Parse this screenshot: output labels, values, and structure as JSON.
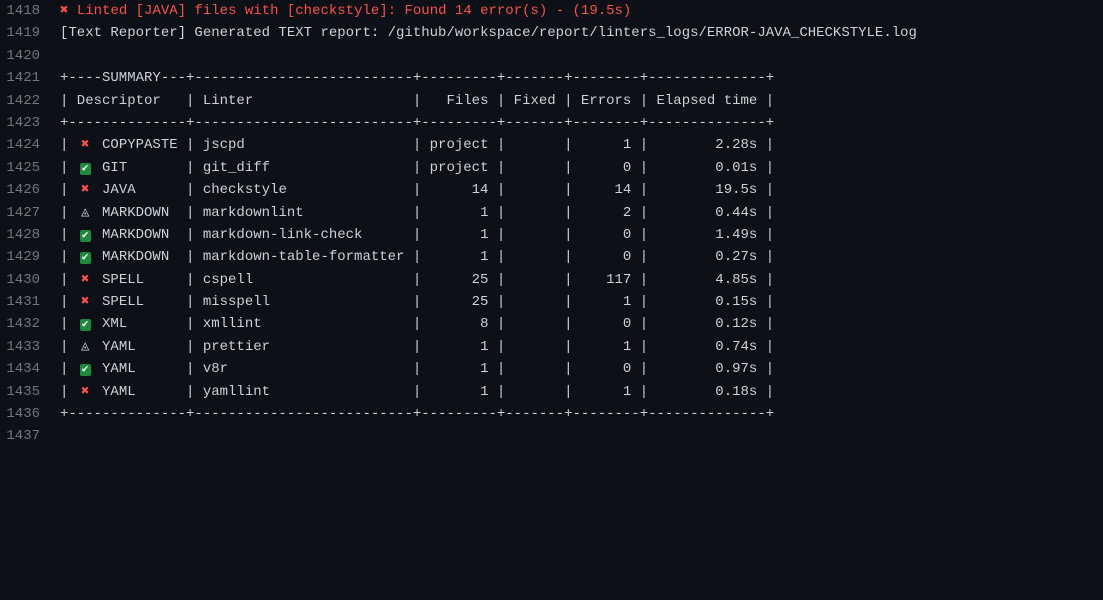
{
  "lines": {
    "l1418_no": "1418",
    "l1419_no": "1419",
    "l1420_no": "1420",
    "l1421_no": "1421",
    "l1422_no": "1422",
    "l1423_no": "1423",
    "l1424_no": "1424",
    "l1425_no": "1425",
    "l1426_no": "1426",
    "l1427_no": "1427",
    "l1428_no": "1428",
    "l1429_no": "1429",
    "l1430_no": "1430",
    "l1431_no": "1431",
    "l1432_no": "1432",
    "l1433_no": "1433",
    "l1434_no": "1434",
    "l1435_no": "1435",
    "l1436_no": "1436",
    "l1437_no": "1437"
  },
  "msg1418_icon": "✖",
  "msg1418_text": " Linted [JAVA] files with [checkstyle]: Found 14 error(s) - (19.5s)",
  "msg1419": "[Text Reporter] Generated TEXT report: /github/workspace/report/linters_logs/ERROR-JAVA_CHECKSTYLE.log",
  "border_top": "+----SUMMARY---+--------------------------+---------+-------+--------+--------------+",
  "header_row": "| Descriptor   | Linter                   |   Files | Fixed | Errors | Elapsed time |",
  "border_mid": "+--------------+--------------------------+---------+-------+--------+--------------+",
  "border_bot": "+--------------+--------------------------+---------+-------+--------+--------------+",
  "icons": {
    "x": "✖",
    "check": "✔",
    "warn": "◬"
  },
  "rows": [
    {
      "status": "x",
      "desc": "COPYPASTE",
      "linter": "jscpd",
      "files": "project",
      "fixed": "",
      "errors": "1",
      "time": "2.28s"
    },
    {
      "status": "check",
      "desc": "GIT",
      "linter": "git_diff",
      "files": "project",
      "fixed": "",
      "errors": "0",
      "time": "0.01s"
    },
    {
      "status": "x",
      "desc": "JAVA",
      "linter": "checkstyle",
      "files": "14",
      "fixed": "",
      "errors": "14",
      "time": "19.5s"
    },
    {
      "status": "warn",
      "desc": "MARKDOWN",
      "linter": "markdownlint",
      "files": "1",
      "fixed": "",
      "errors": "2",
      "time": "0.44s"
    },
    {
      "status": "check",
      "desc": "MARKDOWN",
      "linter": "markdown-link-check",
      "files": "1",
      "fixed": "",
      "errors": "0",
      "time": "1.49s"
    },
    {
      "status": "check",
      "desc": "MARKDOWN",
      "linter": "markdown-table-formatter",
      "files": "1",
      "fixed": "",
      "errors": "0",
      "time": "0.27s"
    },
    {
      "status": "x",
      "desc": "SPELL",
      "linter": "cspell",
      "files": "25",
      "fixed": "",
      "errors": "117",
      "time": "4.85s"
    },
    {
      "status": "x",
      "desc": "SPELL",
      "linter": "misspell",
      "files": "25",
      "fixed": "",
      "errors": "1",
      "time": "0.15s"
    },
    {
      "status": "check",
      "desc": "XML",
      "linter": "xmllint",
      "files": "8",
      "fixed": "",
      "errors": "0",
      "time": "0.12s"
    },
    {
      "status": "warn",
      "desc": "YAML",
      "linter": "prettier",
      "files": "1",
      "fixed": "",
      "errors": "1",
      "time": "0.74s"
    },
    {
      "status": "check",
      "desc": "YAML",
      "linter": "v8r",
      "files": "1",
      "fixed": "",
      "errors": "0",
      "time": "0.97s"
    },
    {
      "status": "x",
      "desc": "YAML",
      "linter": "yamllint",
      "files": "1",
      "fixed": "",
      "errors": "1",
      "time": "0.18s"
    }
  ]
}
